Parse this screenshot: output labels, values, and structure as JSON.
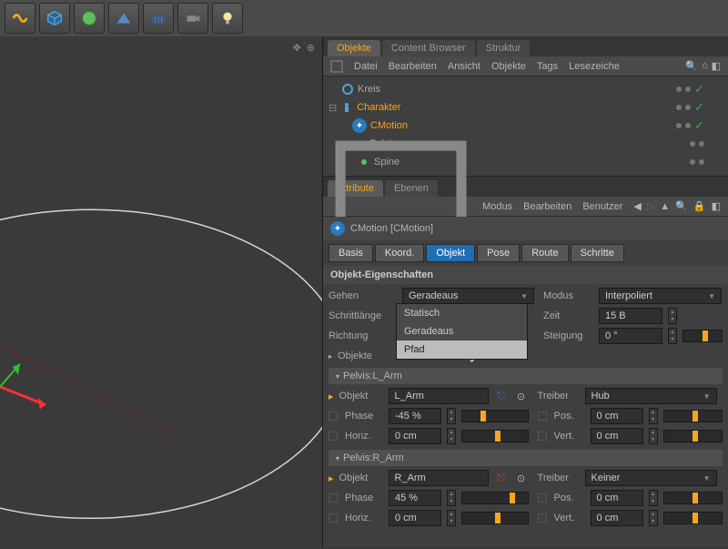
{
  "toolbar_icons": [
    "snake",
    "cube",
    "sphere",
    "wedge",
    "floor",
    "camera",
    "light"
  ],
  "panel_tabs": {
    "objects": "Objekte",
    "content_browser": "Content Browser",
    "struktur": "Struktur"
  },
  "obj_menu": [
    "Datei",
    "Bearbeiten",
    "Ansicht",
    "Objekte",
    "Tags",
    "Lesezeiche"
  ],
  "tree": {
    "kreis": "Kreis",
    "charakter": "Charakter",
    "cmotion": "CMotion",
    "pelvis": "Pelvis",
    "spine": "Spine"
  },
  "attr_tabs": {
    "attribute": "Attribute",
    "ebenen": "Ebenen"
  },
  "attr_menu": [
    "Modus",
    "Bearbeiten",
    "Benutzer"
  ],
  "cmotion_title": "CMotion [CMotion]",
  "subtabs": {
    "basis": "Basis",
    "koord": "Koord.",
    "objekt": "Objekt",
    "pose": "Pose",
    "route": "Route",
    "schritte": "Schritte"
  },
  "props_title": "Objekt-Eigenschaften",
  "labels": {
    "gehen": "Gehen",
    "schrittlaenge": "Schrittlänge",
    "richtung": "Richtung",
    "objekte": "Objekte",
    "modus": "Modus",
    "zeit": "Zeit",
    "steigung": "Steigung",
    "objekt": "Objekt",
    "treiber": "Treiber",
    "phase": "Phase",
    "horiz": "Horiz.",
    "pos": "Pos.",
    "vert": "Vert."
  },
  "values": {
    "gehen": "Geradeaus",
    "modus": "Interpoliert",
    "zeit": "15 B",
    "steigung": "0 °",
    "dd_statisch": "Statisch",
    "dd_geradeaus": "Geradeaus",
    "dd_pfad": "Pfad",
    "pelvis_larm": "Pelvis:L_Arm",
    "pelvis_rarm": "Pelvis:R_Arm",
    "larm_obj": "L_Arm",
    "rarm_obj": "R_Arm",
    "hub": "Hub",
    "keiner": "Keiner",
    "phase_l": "-45 %",
    "phase_r": "45 %",
    "zero_cm": "0 cm"
  }
}
